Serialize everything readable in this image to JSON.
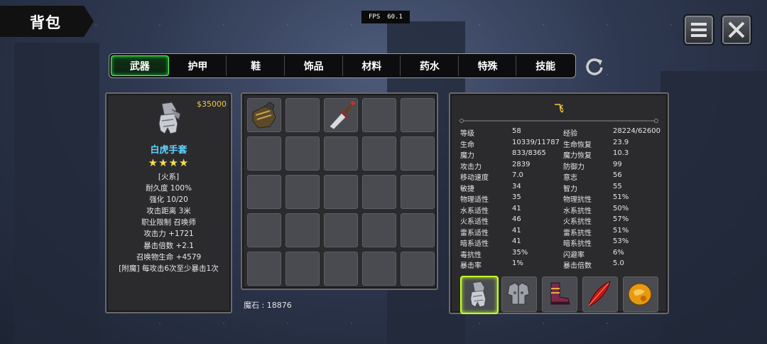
{
  "header": {
    "title": "背包"
  },
  "fps": {
    "label": "FPS",
    "value": "60.1"
  },
  "tabs": [
    {
      "label": "武器",
      "active": true
    },
    {
      "label": "护甲",
      "active": false
    },
    {
      "label": "鞋",
      "active": false
    },
    {
      "label": "饰品",
      "active": false
    },
    {
      "label": "材料",
      "active": false
    },
    {
      "label": "药水",
      "active": false
    },
    {
      "label": "特殊",
      "active": false
    },
    {
      "label": "技能",
      "active": false
    }
  ],
  "item": {
    "price": "$35000",
    "icon": "gauntlet-icon",
    "name": "白虎手套",
    "stars": "★★★★",
    "lines": [
      "[火系]",
      "耐久度 100%",
      "强化 10/20",
      "攻击距离  3米",
      "职业限制  召唤师",
      "攻击力  +1721",
      "暴击倍数  +2.1",
      "召唤物生命  +4579",
      "[附魔] 每攻击6次至少暴击1次"
    ]
  },
  "inventory": {
    "slots": [
      "glove-icon",
      "",
      "dagger-icon",
      "",
      "",
      "",
      "",
      "",
      "",
      "",
      "",
      "",
      "",
      "",
      "",
      "",
      "",
      "",
      "",
      "",
      "",
      "",
      "",
      "",
      ""
    ],
    "magic_stone": "魔石 : 18876"
  },
  "stats": {
    "name": "飞",
    "rows": [
      [
        "等级",
        "58",
        "经验",
        "28224/62600"
      ],
      [
        "生命",
        "10339/11787",
        "生命恢复",
        "23.9"
      ],
      [
        "魔力",
        "833/8365",
        "魔力恢复",
        "10.3"
      ],
      [
        "攻击力",
        "2839",
        "防御力",
        "99"
      ],
      [
        "移动速度",
        "7.0",
        "意志",
        "56"
      ],
      [
        "敏捷",
        "34",
        "智力",
        "55"
      ],
      [
        "物理适性",
        "35",
        "物理抗性",
        "51%"
      ],
      [
        "水系适性",
        "41",
        "水系抗性",
        "50%"
      ],
      [
        "火系适性",
        "46",
        "火系抗性",
        "57%"
      ],
      [
        "雷系适性",
        "41",
        "雷系抗性",
        "51%"
      ],
      [
        "暗系适性",
        "41",
        "暗系抗性",
        "53%"
      ],
      [
        "毒抗性",
        "35%",
        "闪避率",
        "6%"
      ],
      [
        "暴击率",
        "1%",
        "暴击倍数",
        "5.0"
      ]
    ],
    "equipment": [
      {
        "icon": "gauntlet-icon",
        "selected": true
      },
      {
        "icon": "armor-icon",
        "selected": false
      },
      {
        "icon": "boots-icon",
        "selected": false
      },
      {
        "icon": "feather-icon",
        "selected": false
      },
      {
        "icon": "amber-orb-icon",
        "selected": false
      }
    ]
  },
  "colors": {
    "active_tab": "#4fff5a",
    "price": "#f3c64a",
    "item_name": "#5fd3ff",
    "selected_equip": "#c7ff2a"
  }
}
